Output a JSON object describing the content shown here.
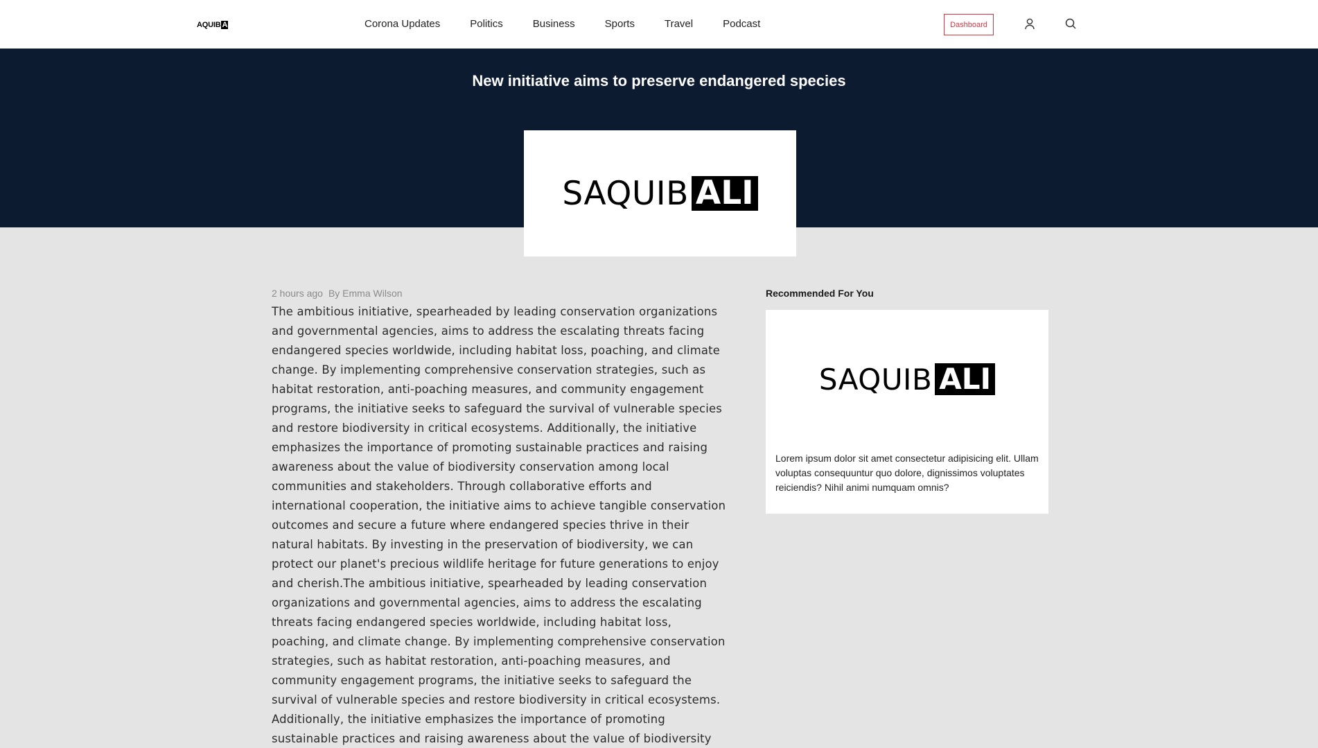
{
  "header": {
    "brand_prefix": "AQUIB",
    "brand_box": "A",
    "nav": [
      "Corona Updates",
      "Politics",
      "Business",
      "Sports",
      "Travel",
      "Podcast"
    ],
    "dashboard_label": "Dashboard",
    "user_icon": "user-icon",
    "search_icon": "search-icon",
    "accent_color": "#e0313f"
  },
  "hero": {
    "title": "New initiative aims to preserve endangered species",
    "background": "#0d1b30",
    "image_logo_text": "SAQUIB",
    "image_logo_box": "ALI"
  },
  "article": {
    "time": "2 hours ago",
    "author": "By Emma Wilson",
    "body": "The ambitious initiative, spearheaded by leading conservation organizations and governmental agencies, aims to address the escalating threats facing endangered species worldwide, including habitat loss, poaching, and climate change. By implementing comprehensive conservation strategies, such as habitat restoration, anti-poaching measures, and community engagement programs, the initiative seeks to safeguard the survival of vulnerable species and restore biodiversity in critical ecosystems. Additionally, the initiative emphasizes the importance of promoting sustainable practices and raising awareness about the value of biodiversity conservation among local communities and stakeholders. Through collaborative efforts and international cooperation, the initiative aims to achieve tangible conservation outcomes and secure a future where endangered species thrive in their natural habitats. By investing in the preservation of biodiversity, we can protect our planet's precious wildlife heritage for future generations to enjoy and cherish.The ambitious initiative, spearheaded by leading conservation organizations and governmental agencies, aims to address the escalating threats facing endangered species worldwide, including habitat loss, poaching, and climate change. By implementing comprehensive conservation strategies, such as habitat restoration, anti-poaching measures, and community engagement programs, the initiative seeks to safeguard the survival of vulnerable species and restore biodiversity in critical ecosystems. Additionally, the initiative emphasizes the importance of promoting sustainable practices and raising awareness about the value of biodiversity conservation among local"
  },
  "sidebar": {
    "title": "Recommended For You",
    "card": {
      "logo_text": "SAQUIB",
      "logo_box": "ALI",
      "text": "Lorem ipsum dolor sit amet consectetur adipisicing elit. Ullam voluptas consequuntur quo dolore, dignissimos voluptates reiciendis? Nihil animi numquam omnis?"
    }
  }
}
